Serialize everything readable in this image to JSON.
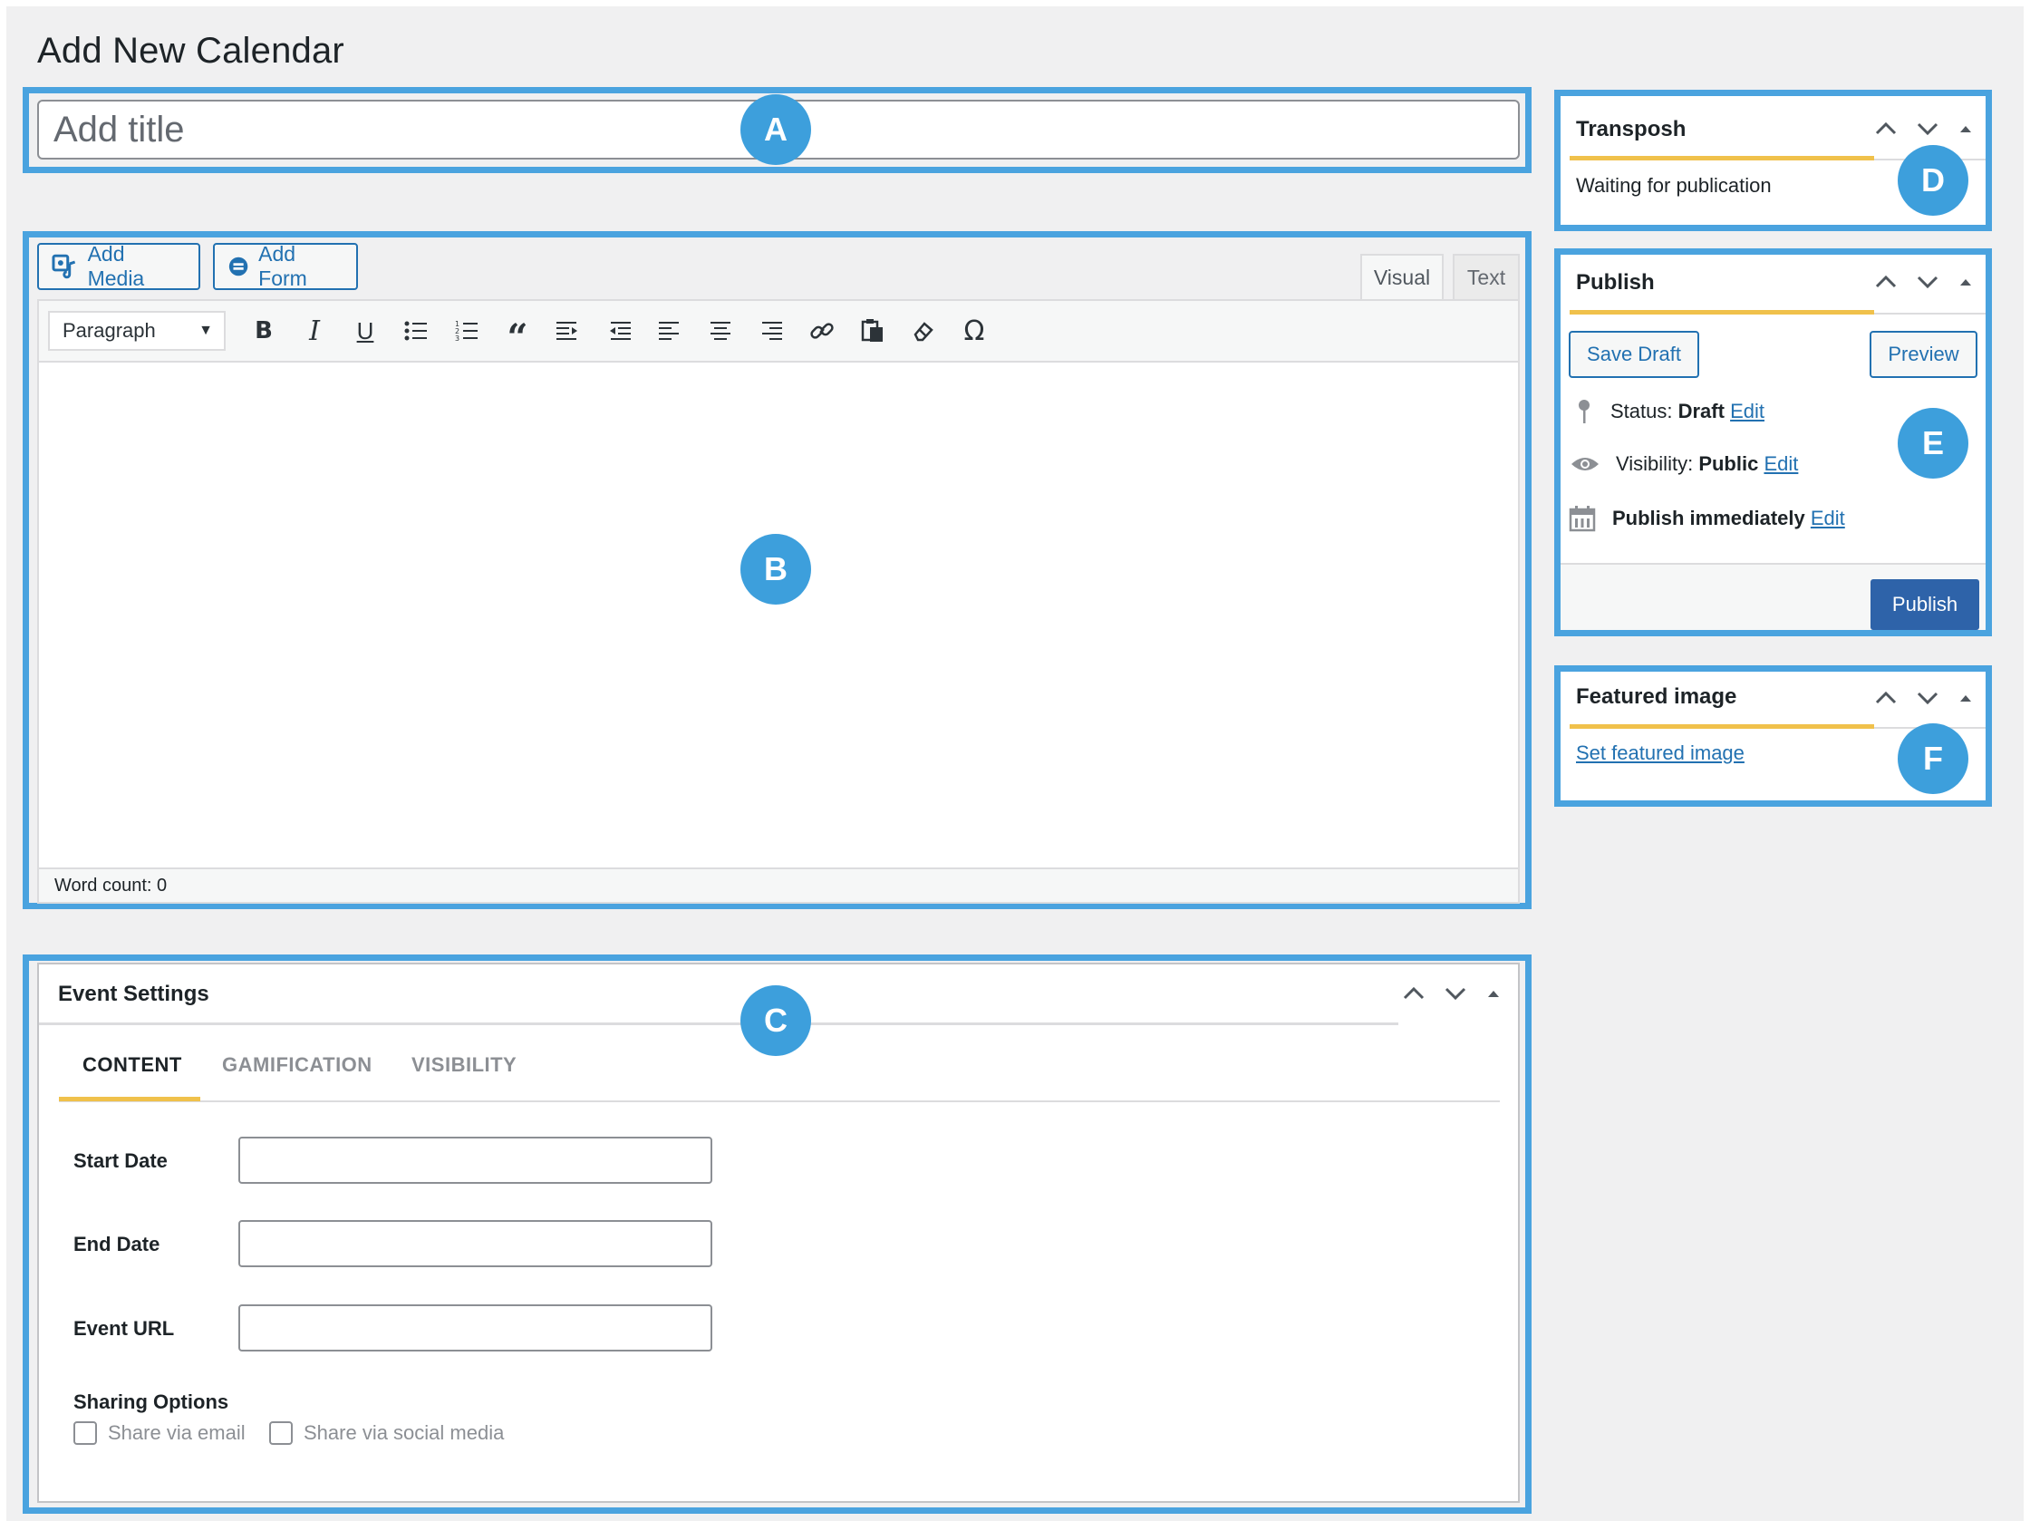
{
  "page": {
    "title": "Add New Calendar"
  },
  "title_field": {
    "placeholder": "Add title"
  },
  "markers": {
    "a": "A",
    "b": "B",
    "c": "C",
    "d": "D",
    "e": "E",
    "f": "F"
  },
  "editor": {
    "add_media": "Add Media",
    "add_form": "Add Form",
    "tabs": [
      "Visual",
      "Text"
    ],
    "format_select": "Paragraph",
    "toolbar_icons": [
      "bold-icon",
      "italic-icon",
      "underline-icon",
      "bullet-list-icon",
      "numbered-list-icon",
      "blockquote-icon",
      "indent-icon",
      "outdent-icon",
      "align-left-icon",
      "align-center-icon",
      "align-right-icon",
      "link-icon",
      "paste-icon",
      "eraser-icon",
      "omega-icon"
    ],
    "word_count": "Word count: 0"
  },
  "event_settings": {
    "title": "Event Settings",
    "tabs": [
      "CONTENT",
      "GAMIFICATION",
      "VISIBILITY"
    ],
    "active_tab": "CONTENT",
    "fields": [
      {
        "label": "Start Date",
        "value": ""
      },
      {
        "label": "End Date",
        "value": ""
      },
      {
        "label": "Event URL",
        "value": ""
      }
    ],
    "sharing": {
      "label": "Sharing Options",
      "options": [
        "Share via email",
        "Share via social media"
      ]
    }
  },
  "transposh": {
    "title": "Transposh",
    "status": "Waiting for publication"
  },
  "publish": {
    "title": "Publish",
    "save_draft": "Save Draft",
    "preview": "Preview",
    "status_label": "Status:",
    "status_value": "Draft",
    "visibility_label": "Visibility:",
    "visibility_value": "Public",
    "schedule_label": "Publish immediately",
    "edit": "Edit",
    "publish_button": "Publish"
  },
  "featured_image": {
    "title": "Featured image",
    "link": "Set featured image"
  },
  "colors": {
    "highlight": "#4aa3df",
    "marker": "#3d9fdc",
    "accent": "#2271b1",
    "tab_underline": "#f0c14b",
    "publish_button": "#2e63a9"
  }
}
